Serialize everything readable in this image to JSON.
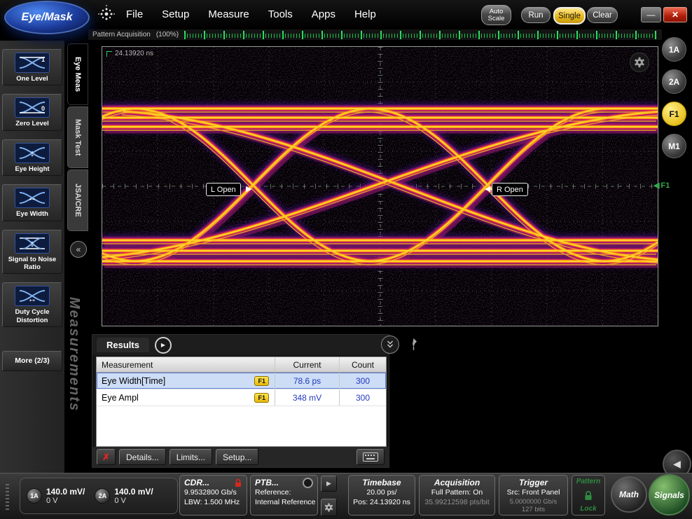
{
  "window": {
    "title_logo": "Eye/Mask"
  },
  "menu": {
    "items": [
      "File",
      "Setup",
      "Measure",
      "Tools",
      "Apps",
      "Help"
    ]
  },
  "controls": {
    "auto_scale": "Auto Scale",
    "run": "Run",
    "single": "Single",
    "clear": "Clear"
  },
  "acq": {
    "label": "Pattern Acquisition",
    "percent": "(100%)"
  },
  "sidebar": {
    "title": "Measurements",
    "items": [
      {
        "label": "One Level"
      },
      {
        "label": "Zero Level"
      },
      {
        "label": "Eye Height"
      },
      {
        "label": "Eye Width"
      },
      {
        "label": "Signal to Noise Ratio"
      },
      {
        "label": "Duty Cycle Distortion"
      }
    ],
    "more_label": "More (2/3)"
  },
  "tabs": {
    "items": [
      "Eye Meas",
      "Mask Test",
      "JSA/CRE"
    ]
  },
  "graph": {
    "timebase_readout": "24.13920 ns",
    "l_open_label": "L Open",
    "r_open_label": "R Open",
    "f1_marker": "F1"
  },
  "channel_buttons": {
    "items": [
      "1A",
      "2A",
      "F1",
      "M1"
    ]
  },
  "results": {
    "title": "Results",
    "columns": [
      "Measurement",
      "Current",
      "Count"
    ],
    "rows": [
      {
        "name": "Eye Width[Time]",
        "source": "F1",
        "current": "78.6 ps",
        "count": "300"
      },
      {
        "name": "Eye Ampl",
        "source": "F1",
        "current": "348 mV",
        "count": "300"
      }
    ],
    "details_btn": "Details...",
    "limits_btn": "Limits...",
    "setup_btn": "Setup..."
  },
  "statusbar": {
    "ch1_label": "1A",
    "ch1_scale": "140.0 mV/",
    "ch1_offset": "0 V",
    "ch2_label": "2A",
    "ch2_scale": "140.0 mV/",
    "ch2_offset": "0 V",
    "cdr_title": "CDR...",
    "cdr_rate": "9.9532800 Gb/s",
    "cdr_lbw": "LBW: 1.500 MHz",
    "ptb_title": "PTB...",
    "ptb_ref_label": "Reference:",
    "ptb_ref_value": "Internal Reference",
    "timebase_title": "Timebase",
    "timebase_scale": "20.00 ps/",
    "timebase_pos": "Pos: 24.13920 ns",
    "acq_title": "Acquisition",
    "acq_line1": "Full Pattern: On",
    "acq_line2": "35.99212598 pts/bit",
    "trig_title": "Trigger",
    "trig_src": "Src: Front Panel",
    "trig_rate": "5.0000000 Gb/s",
    "trig_bits": "127 bits",
    "pattern_title": "Pattern",
    "pattern_lock": "Lock",
    "math_label": "Math",
    "signals_label": "Signals"
  }
}
